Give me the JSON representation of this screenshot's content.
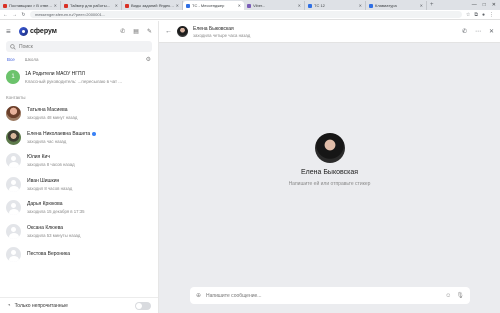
{
  "browser": {
    "tabs": [
      {
        "title": "Поставщики > В ответ...",
        "color": "#d93025"
      },
      {
        "title": "Таймер для работы...",
        "color": "#d93025"
      },
      {
        "title": "Виды заданий Яндекс...",
        "color": "#d93025"
      },
      {
        "title": "ТС - Мессенджер",
        "color": "#2f6fe4",
        "active": true
      },
      {
        "title": "Viber...",
        "color": "#7a5cb8"
      },
      {
        "title": "ТС 12",
        "color": "#2f6fe4"
      },
      {
        "title": "Клавиатура",
        "color": "#2f6fe4"
      }
    ],
    "new_tab": "+",
    "window_controls": [
      "—",
      "□",
      "✕"
    ],
    "url": "messenger.sferum.ru/?peer=2000001..."
  },
  "sidebar": {
    "logo_text": "сферум",
    "search_placeholder": "Поиск",
    "filters": [
      {
        "label": "Все",
        "active": true
      },
      {
        "label": "Школа",
        "active": false
      }
    ],
    "group_chat": {
      "avatar_letter": "1",
      "name": "1А   Родители   МАОУ НГПЛ",
      "last_message": "Классный руководитель: ...пересылаю в чат ...",
      "time": "11:00"
    },
    "contacts_label": "Контакты",
    "contacts": [
      {
        "name": "Татьяна Масиева",
        "status": "заходила 48 минут назад",
        "avatar": "photo1",
        "verified": false
      },
      {
        "name": "Елена Николаевна Вашета",
        "status": "заходила час назад",
        "avatar": "photo2",
        "verified": true
      },
      {
        "name": "Юлия Кич",
        "status": "заходила 8 часов назад",
        "avatar": "ph",
        "verified": false
      },
      {
        "name": "Иван Шишкин",
        "status": "заходил 8 часов назад",
        "avatar": "ph",
        "verified": false
      },
      {
        "name": "Дарья Крюкова",
        "status": "заходила 15 декабря в 17:35",
        "avatar": "ph",
        "verified": false
      },
      {
        "name": "Оксана Клюева",
        "status": "заходила 53 минуты назад",
        "avatar": "ph",
        "verified": false
      },
      {
        "name": "Пестова Вероника",
        "status": "",
        "avatar": "ph",
        "verified": false
      }
    ],
    "footer_label": "Только непрочитанные"
  },
  "chat": {
    "name": "Елена Быковская",
    "status": "заходила четыре часа назад",
    "empty_hint": "Напишите ей или отправьте стикер",
    "composer_placeholder": "Напишите сообщение..."
  }
}
